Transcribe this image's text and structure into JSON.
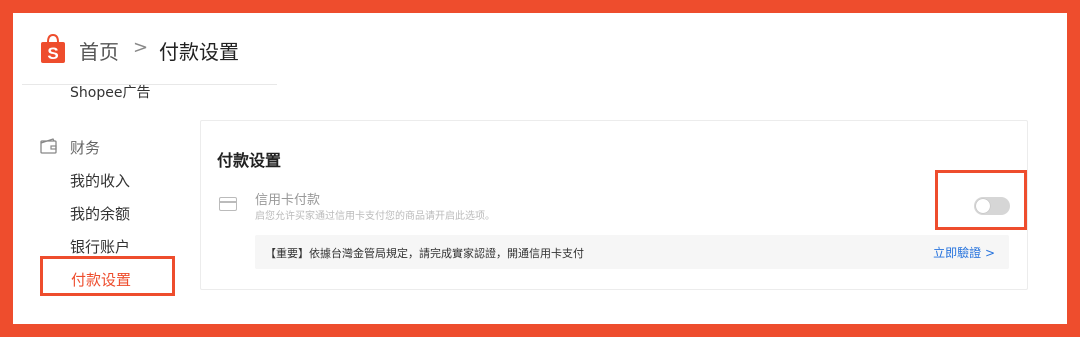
{
  "header": {
    "breadcrumb_home": "首页",
    "breadcrumb_separator": ">",
    "breadcrumb_current": "付款设置",
    "logo_icon": "shopee-bag-icon",
    "brand_color": "#ee4d2d"
  },
  "sidebar": {
    "ads_label": "Shopee广告",
    "finance_label": "财务",
    "finance_icon": "wallet-icon",
    "items": [
      {
        "label": "我的收入"
      },
      {
        "label": "我的余额"
      },
      {
        "label": "银行账户"
      },
      {
        "label": "付款设置",
        "active": true
      }
    ]
  },
  "main": {
    "title": "付款设置",
    "credit_card": {
      "icon": "credit-card-icon",
      "label": "信用卡付款",
      "description": "启您允许买家通过信用卡支付您的商品请开启此选项。",
      "toggle_on": false
    },
    "notice": {
      "text": "【重要】依據台灣金管局規定，請完成實家認證，開通信用卡支付",
      "link_label": "立即驗證",
      "link_arrow": ">",
      "link_color": "#2673dd"
    }
  }
}
